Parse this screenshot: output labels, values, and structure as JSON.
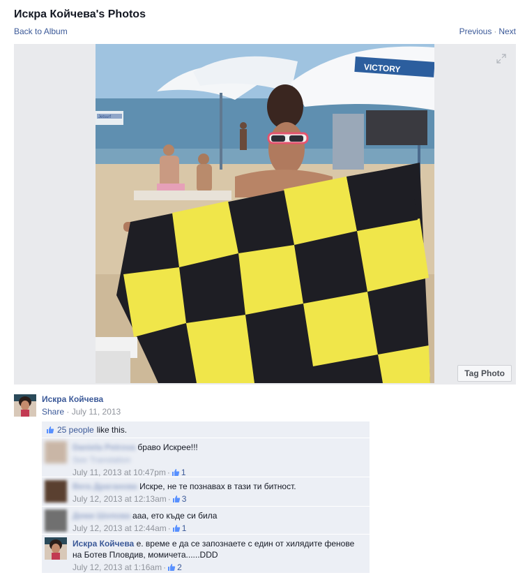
{
  "header": {
    "title": "Искра Койчева's Photos",
    "back_label": "Back to Album",
    "previous_label": "Previous",
    "separator": "·",
    "next_label": "Next"
  },
  "photo": {
    "tag_button": "Tag Photo",
    "umbrella_text": "VICTORY",
    "boat_text": "Jetsurf"
  },
  "owner": {
    "name": "Искра Койчева",
    "share_label": "Share",
    "separator": "·",
    "date": "July 11, 2013"
  },
  "likes": {
    "count_label": "25 people",
    "suffix": "like this."
  },
  "comments": [
    {
      "author": "Daniela Petrova",
      "text": "браво Искрее!!!",
      "extra": "See Translation",
      "time": "July 11, 2013 at 10:47pm",
      "sep": "·",
      "likes": "1"
    },
    {
      "author": "Bera Драганова",
      "text": "Искре, не те познавах в тази ти битност.",
      "time": "July 12, 2013 at 12:13am",
      "sep": "·",
      "likes": "3"
    },
    {
      "author": "Деми Шопова",
      "text": "ааа, ето къде си била",
      "time": "July 12, 2013 at 12:44am",
      "sep": "·",
      "likes": "1"
    },
    {
      "author": "Искра Койчева",
      "text": "е. време е да се запознаете с един от хилядите фенове на Ботев Пловдив, момичета......DDD",
      "time": "July 12, 2013 at 1:16am",
      "sep": "·",
      "likes": "2"
    }
  ],
  "colors": {
    "link": "#3b5998",
    "ufi_bg": "#eceff5",
    "stage_bg": "#e9eaed",
    "flag_yellow": "#f0e64a",
    "flag_black": "#1e1e24"
  }
}
